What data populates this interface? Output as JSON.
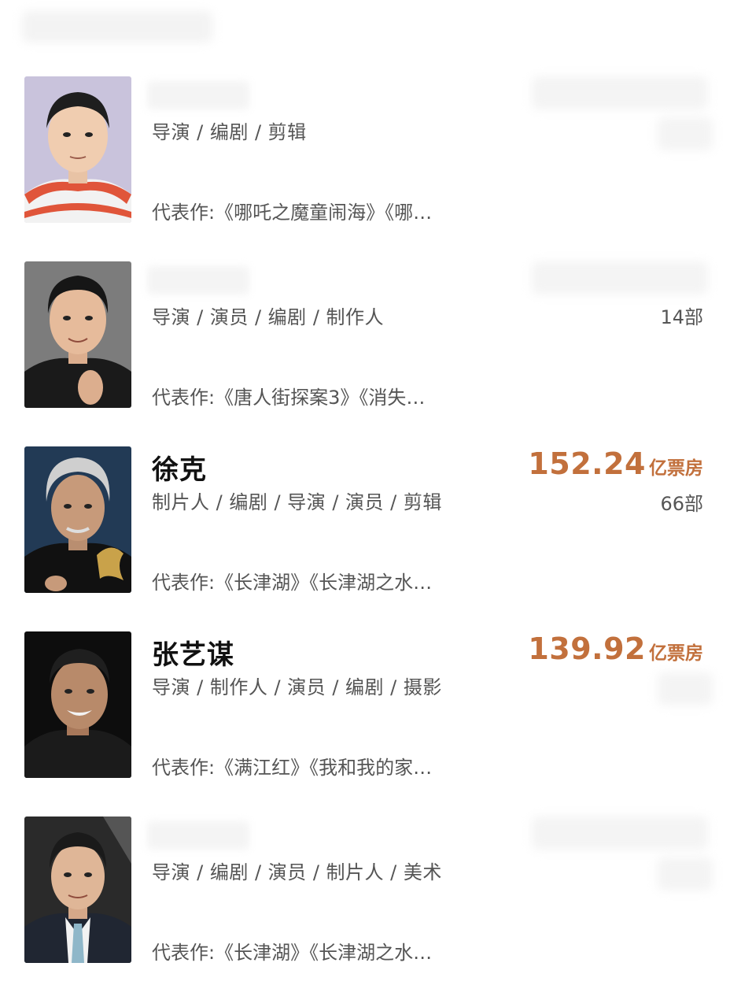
{
  "people": [
    {
      "name": "",
      "roles": "导演 / 编剧 / 剪辑",
      "works": "代表作:《哪吒之魔童闹海》《哪…",
      "box_office": "",
      "box_office_unit": "",
      "film_count": "",
      "accent_color": "#c2703c"
    },
    {
      "name": "",
      "roles": "导演 / 演员 / 编剧 / 制作人",
      "works": "代表作:《唐人街探案3》《消失…",
      "box_office": "",
      "box_office_unit": "",
      "film_count": "14部",
      "accent_color": "#c2703c"
    },
    {
      "name": "徐克",
      "roles": "制片人 / 编剧 / 导演 / 演员 / 剪辑",
      "works": "代表作:《长津湖》《长津湖之水…",
      "box_office": "152.24",
      "box_office_unit": "亿票房",
      "film_count": "66部",
      "accent_color": "#c2703c"
    },
    {
      "name": "张艺谋",
      "roles": "导演 / 制作人 / 演员 / 编剧 / 摄影",
      "works": "代表作:《满江红》《我和我的家…",
      "box_office": "139.92",
      "box_office_unit": "亿票房",
      "film_count": "",
      "accent_color": "#c2703c"
    },
    {
      "name": "",
      "roles": "导演 / 编剧 / 演员 / 制片人 / 美术",
      "works": "代表作:《长津湖》《长津湖之水…",
      "box_office": "",
      "box_office_unit": "",
      "film_count": "",
      "accent_color": "#c2703c"
    }
  ]
}
